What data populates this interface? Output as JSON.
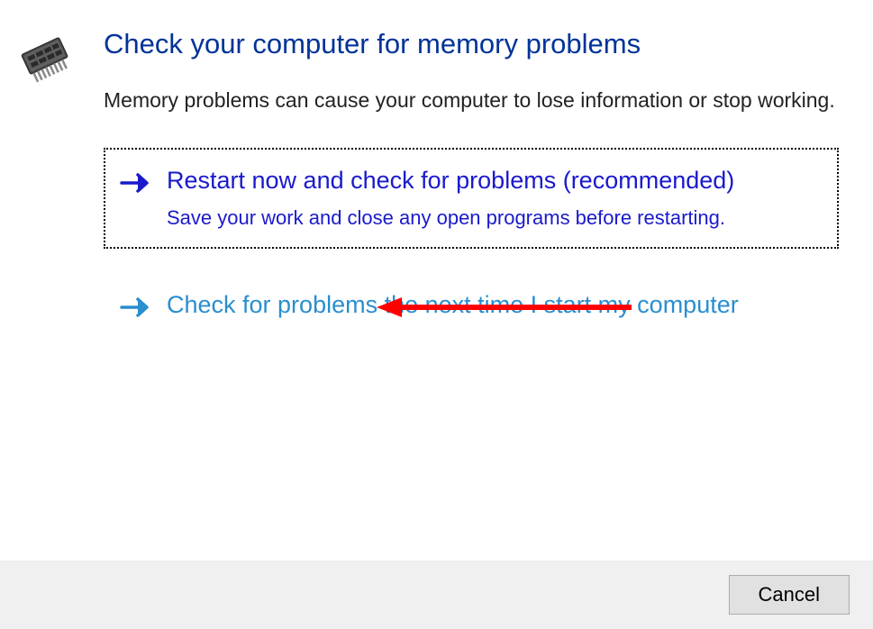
{
  "heading": "Check your computer for memory problems",
  "subtext": "Memory problems can cause your computer to lose information or stop working.",
  "options": [
    {
      "title": "Restart now and check for problems (recommended)",
      "desc": "Save your work and close any open programs before restarting."
    },
    {
      "title": "Check for problems the next time I start my computer",
      "desc": ""
    }
  ],
  "buttons": {
    "cancel": "Cancel"
  },
  "colors": {
    "primary_link": "#1a1acc",
    "secondary_link": "#2a8ecf",
    "annotation": "#ff0000"
  }
}
